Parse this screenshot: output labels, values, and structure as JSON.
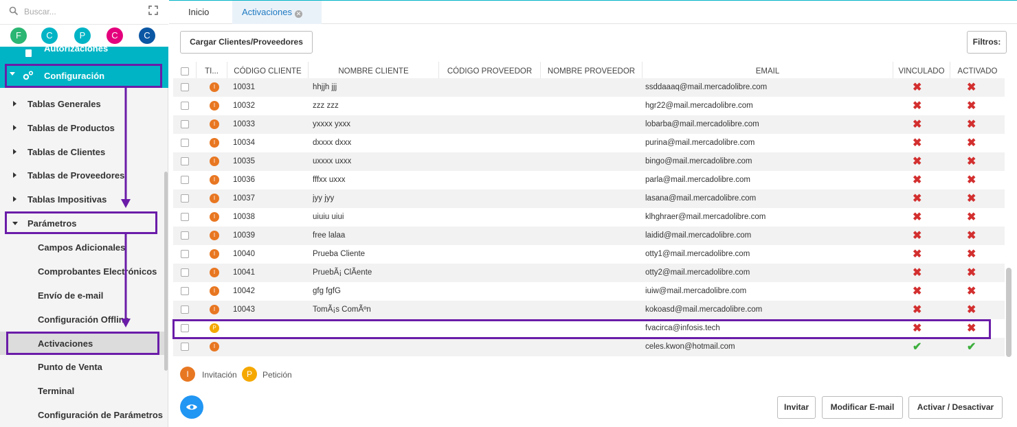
{
  "sidebar": {
    "search_placeholder": "Buscar...",
    "circles": [
      {
        "letter": "F",
        "color": "#2bb673"
      },
      {
        "letter": "C",
        "color": "#00b4c5"
      },
      {
        "letter": "P",
        "color": "#00b4c5"
      },
      {
        "letter": "C",
        "color": "#e4007c"
      },
      {
        "letter": "C",
        "color": "#0b57a4"
      }
    ],
    "partial_item": "Autorizaciones",
    "config_label": "Configuración",
    "items": [
      "Tablas Generales",
      "Tablas de Productos",
      "Tablas de Clientes",
      "Tablas de Proveedores",
      "Tablas Impositivas"
    ],
    "params_label": "Parámetros",
    "sub_items": [
      "Campos Adicionales",
      "Comprobantes Electrónicos",
      "Envío de e-mail",
      "Configuración Offline",
      "Activaciones",
      "Punto de Venta",
      "Terminal",
      "Configuración de Parámetros"
    ]
  },
  "tabs": {
    "inicio": "Inicio",
    "activaciones": "Activaciones"
  },
  "toolbar": {
    "cargar": "Cargar Clientes/Proveedores",
    "filtros": "Filtros:"
  },
  "columns": {
    "tipo": "TI...",
    "codigo_cliente": "CÓDIGO CLIENTE",
    "nombre_cliente": "NOMBRE CLIENTE",
    "codigo_proveedor": "CÓDIGO PROVEEDOR",
    "nombre_proveedor": "NOMBRE PROVEEDOR",
    "email": "EMAIL",
    "vinculado": "VINCULADO",
    "activado": "ACTIVADO"
  },
  "rows": [
    {
      "tipo": "I",
      "codigo": "10031",
      "nombre": "hhjjh jjj",
      "email": "ssddaaaq@mail.mercadolibre.com",
      "vinculado": false,
      "activado": false
    },
    {
      "tipo": "I",
      "codigo": "10032",
      "nombre": "zzz zzz",
      "email": "hgr22@mail.mercadolibre.com",
      "vinculado": false,
      "activado": false
    },
    {
      "tipo": "I",
      "codigo": "10033",
      "nombre": "yxxxx yxxx",
      "email": "lobarba@mail.mercadolibre.com",
      "vinculado": false,
      "activado": false
    },
    {
      "tipo": "I",
      "codigo": "10034",
      "nombre": "dxxxx dxxx",
      "email": "purina@mail.mercadolibre.com",
      "vinculado": false,
      "activado": false
    },
    {
      "tipo": "I",
      "codigo": "10035",
      "nombre": "uxxxx uxxx",
      "email": "bingo@mail.mercadolibre.com",
      "vinculado": false,
      "activado": false
    },
    {
      "tipo": "I",
      "codigo": "10036",
      "nombre": "fffxx uxxx",
      "email": "parla@mail.mercadolibre.com",
      "vinculado": false,
      "activado": false
    },
    {
      "tipo": "I",
      "codigo": "10037",
      "nombre": "jyy jyy",
      "email": "lasana@mail.mercadolibre.com",
      "vinculado": false,
      "activado": false
    },
    {
      "tipo": "I",
      "codigo": "10038",
      "nombre": "uiuiu uiui",
      "email": "klhghraer@mail.mercadolibre.com",
      "vinculado": false,
      "activado": false
    },
    {
      "tipo": "I",
      "codigo": "10039",
      "nombre": "free lalaa",
      "email": "laidid@mail.mercadolibre.com",
      "vinculado": false,
      "activado": false
    },
    {
      "tipo": "I",
      "codigo": "10040",
      "nombre": "Prueba Cliente",
      "email": "otty1@mail.mercadolibre.com",
      "vinculado": false,
      "activado": false
    },
    {
      "tipo": "I",
      "codigo": "10041",
      "nombre": "PruebÃ¡ ClÃ­ente",
      "email": "otty2@mail.mercadolibre.com",
      "vinculado": false,
      "activado": false
    },
    {
      "tipo": "I",
      "codigo": "10042",
      "nombre": "gfg fgfG",
      "email": "iuiw@mail.mercadolibre.com",
      "vinculado": false,
      "activado": false
    },
    {
      "tipo": "I",
      "codigo": "10043",
      "nombre": "TomÃ¡s ComÃºn",
      "email": "kokoasd@mail.mercadolibre.com",
      "vinculado": false,
      "activado": false
    },
    {
      "tipo": "P",
      "codigo": "",
      "nombre": "",
      "email": "fvacirca@infosis.tech",
      "vinculado": false,
      "activado": false
    },
    {
      "tipo": "I",
      "codigo": "",
      "nombre": "",
      "email": "celes.kwon@hotmail.com",
      "vinculado": true,
      "activado": true
    }
  ],
  "legend": {
    "invitacion_letter": "I",
    "invitacion": "Invitación",
    "peticion_letter": "P",
    "peticion": "Petición"
  },
  "buttons": {
    "invitar": "Invitar",
    "modificar": "Modificar E-mail",
    "activar": "Activar / Desactivar"
  },
  "colors": {
    "accent": "#00b4c5",
    "highlight": "#6a1ca8",
    "invitacion": "#e87722",
    "peticion": "#f5a800",
    "no": "#d32f2f",
    "yes": "#3caf3c"
  }
}
